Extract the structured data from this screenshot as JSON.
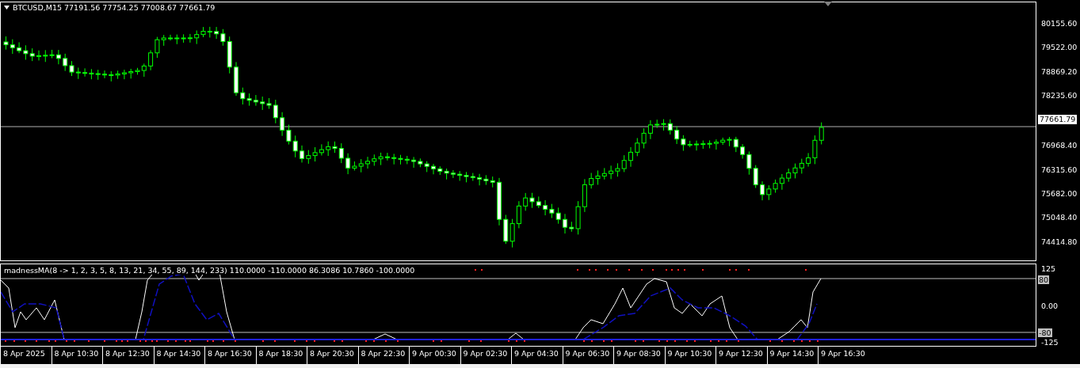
{
  "chart": {
    "header": "BTCUSD,M15  77191.56 77754.25 77008.67 77661.79"
  },
  "price_axis": [
    {
      "label": "80155.60",
      "kind": "tick"
    },
    {
      "label": "79522.00",
      "kind": "tick"
    },
    {
      "label": "78869.20",
      "kind": "tick"
    },
    {
      "label": "78235.60",
      "kind": "tick"
    },
    {
      "label": "77661.79",
      "kind": "current"
    },
    {
      "label": "76968.40",
      "kind": "tick"
    },
    {
      "label": "76315.60",
      "kind": "tick"
    },
    {
      "label": "75682.00",
      "kind": "tick"
    },
    {
      "label": "75048.40",
      "kind": "tick"
    },
    {
      "label": "74414.80",
      "kind": "tick"
    }
  ],
  "indicator": {
    "header": "madnessMA(8 -> 1, 2, 3, 5, 8, 13, 21, 34, 55, 89, 144, 233) 110.0000 -110.0000 86.3086 10.7860 -100.0000",
    "axis": [
      {
        "label": "125",
        "kind": "tick"
      },
      {
        "label": "80",
        "kind": "level"
      },
      {
        "label": "0.00",
        "kind": "tick"
      },
      {
        "label": "-80",
        "kind": "level"
      },
      {
        "label": "-125",
        "kind": "tick"
      }
    ]
  },
  "time_axis": [
    "8 Apr 2025",
    "8 Apr 10:30",
    "8 Apr 12:30",
    "8 Apr 14:30",
    "8 Apr 16:30",
    "8 Apr 18:30",
    "8 Apr 20:30",
    "8 Apr 22:30",
    "9 Apr 00:30",
    "9 Apr 02:30",
    "9 Apr 04:30",
    "9 Apr 06:30",
    "9 Apr 08:30",
    "9 Apr 10:30",
    "9 Apr 12:30",
    "9 Apr 14:30",
    "9 Apr 16:30"
  ]
}
